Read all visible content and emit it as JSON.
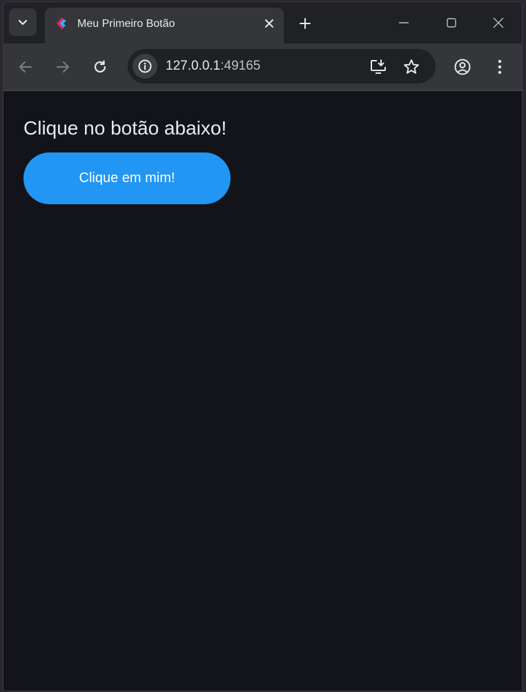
{
  "tab": {
    "title": "Meu Primeiro Botão"
  },
  "address_bar": {
    "host": "127.0.0.1",
    "port": ":49165"
  },
  "page": {
    "heading": "Clique no botão abaixo!",
    "button_label": "Clique em mim!"
  },
  "colors": {
    "page_background": "#121419",
    "button": "#2196f3",
    "toolbar": "#35363a",
    "tabstrip": "#202124"
  },
  "icons": {
    "tab_search": "chevron-down-icon",
    "favicon": "flutter-logo-icon",
    "tab_close": "close-icon",
    "new_tab": "plus-icon",
    "minimize": "minimize-icon",
    "maximize": "maximize-icon",
    "close_window": "close-icon",
    "back": "arrow-left-icon",
    "forward": "arrow-right-icon",
    "reload": "reload-icon",
    "site_info": "info-icon",
    "install_app": "install-app-icon",
    "bookmark": "star-icon",
    "profile": "account-circle-icon",
    "menu": "more-vert-icon"
  }
}
